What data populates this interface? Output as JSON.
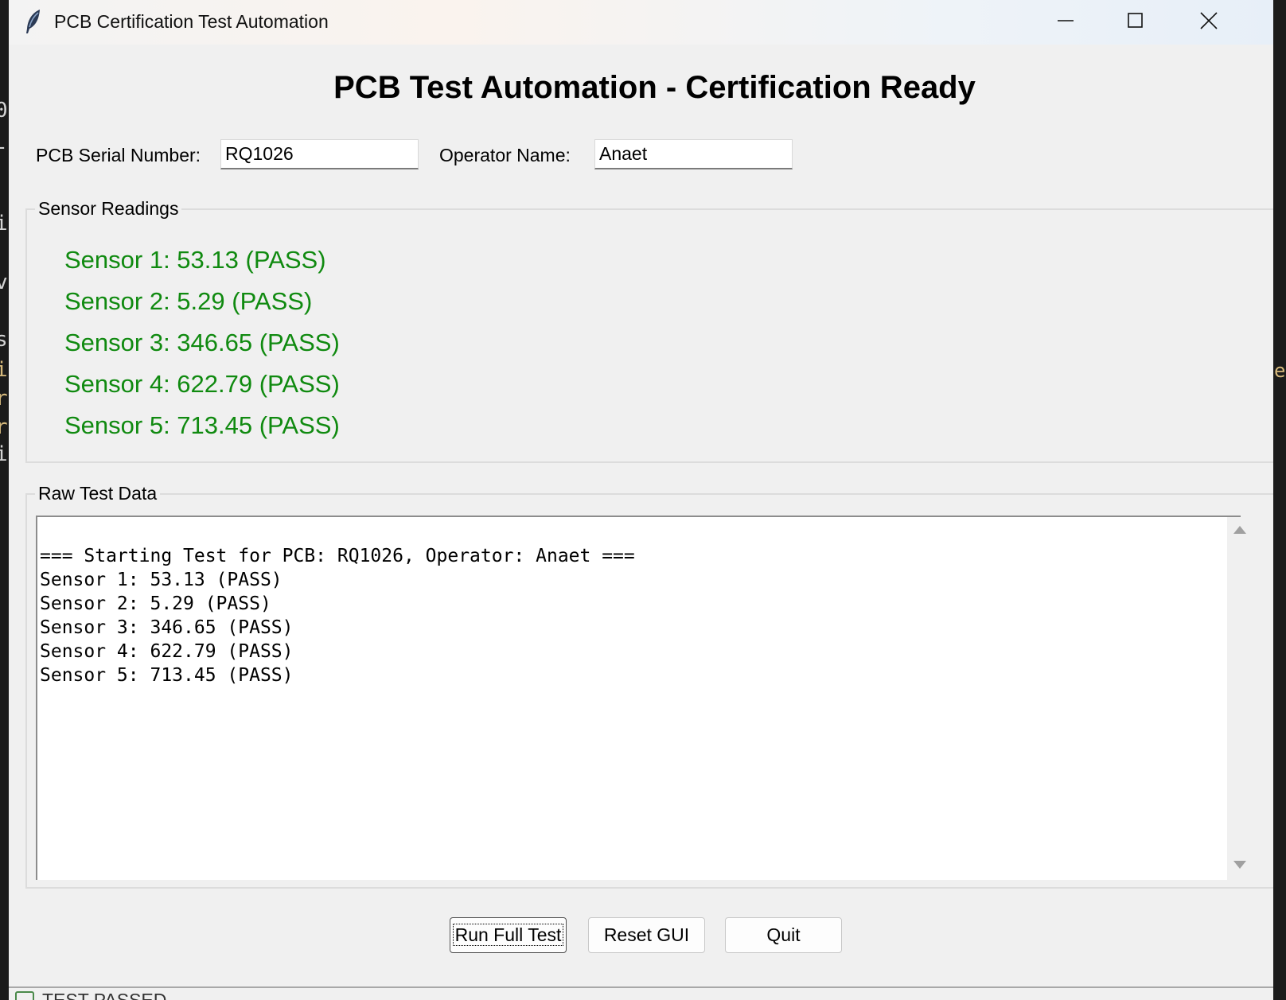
{
  "window": {
    "title": "PCB Certification Test Automation"
  },
  "header": {
    "title": "PCB Test Automation - Certification Ready"
  },
  "form": {
    "serial_label": "PCB Serial Number:",
    "serial_value": "RQ1026",
    "operator_label": "Operator Name:",
    "operator_value": "Anaet"
  },
  "sensor_readings": {
    "title": "Sensor Readings",
    "items": [
      {
        "label": "Sensor 1: 53.13 (PASS)",
        "value": 53.13,
        "status": "PASS"
      },
      {
        "label": "Sensor 2: 5.29 (PASS)",
        "value": 5.29,
        "status": "PASS"
      },
      {
        "label": "Sensor 3: 346.65 (PASS)",
        "value": 346.65,
        "status": "PASS"
      },
      {
        "label": "Sensor 4: 622.79 (PASS)",
        "value": 622.79,
        "status": "PASS"
      },
      {
        "label": "Sensor 5: 713.45 (PASS)",
        "value": 713.45,
        "status": "PASS"
      }
    ],
    "pass_color": "#108a10"
  },
  "raw_data": {
    "title": "Raw Test Data",
    "lines": [
      "=== Starting Test for PCB: RQ1026, Operator: Anaet ===",
      "Sensor 1: 53.13 (PASS)",
      "Sensor 2: 5.29 (PASS)",
      "Sensor 3: 346.65 (PASS)",
      "Sensor 4: 622.79 (PASS)",
      "Sensor 5: 713.45 (PASS)"
    ]
  },
  "buttons": {
    "run_label": "Run Full Test",
    "reset_label": "Reset GUI",
    "quit_label": "Quit"
  },
  "status": {
    "text": "TEST PASSED"
  },
  "icons": {
    "app": "feather-icon",
    "minimize": "minimize-icon",
    "maximize": "maximize-icon",
    "close": "close-icon"
  }
}
